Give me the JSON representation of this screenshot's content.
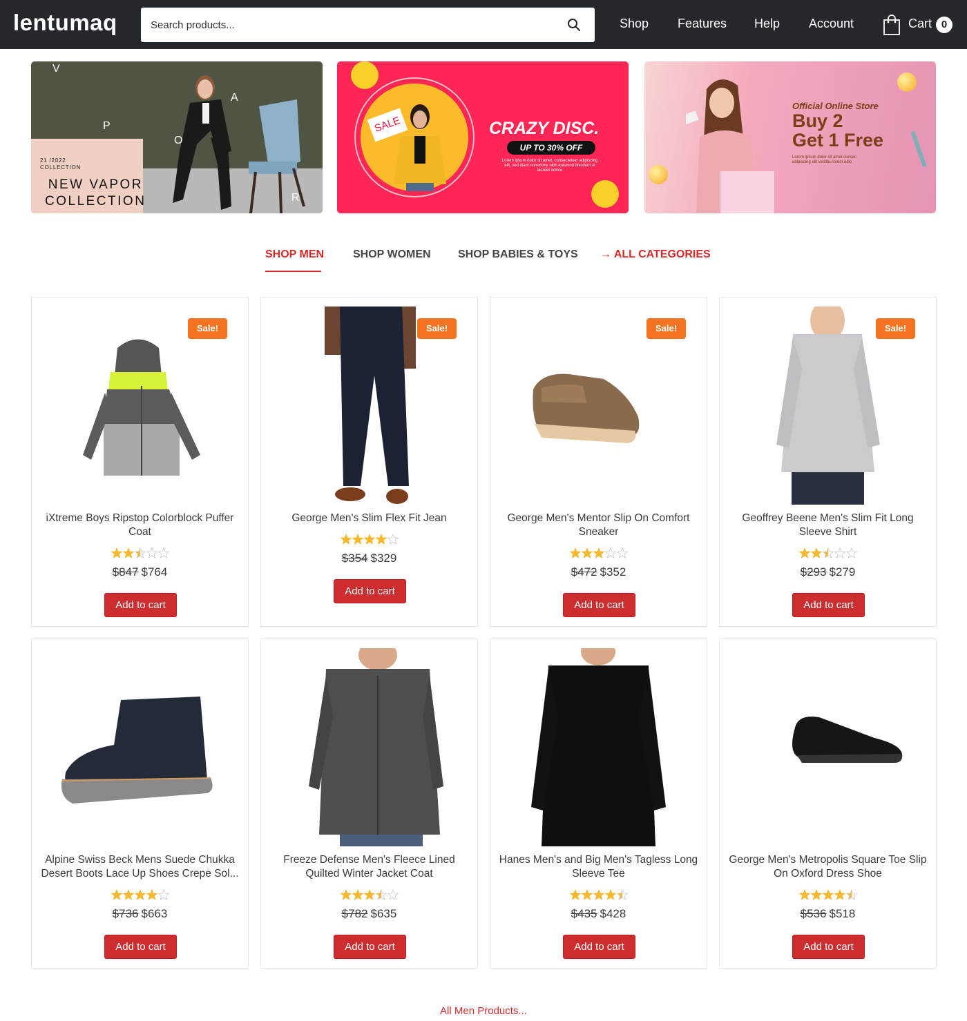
{
  "header": {
    "logo": "lentumaq",
    "search_placeholder": "Search products...",
    "search_icon": "search-icon",
    "nav": [
      "Shop",
      "Features",
      "Help",
      "Account"
    ],
    "cart_label": "Cart",
    "cart_count": "0",
    "cart_icon": "shopping-bag-icon"
  },
  "banners": [
    {
      "letters": [
        "V",
        "A",
        "P",
        "O",
        "R"
      ],
      "small_line1": "21 /2022",
      "small_line2": "COLLECTION",
      "title_line1": "NEW VAPOR",
      "title_line2": "COLLECTION"
    },
    {
      "sign": "SALE",
      "title": "CRAZY DISC.",
      "pill": "UP TO 30% OFF",
      "lorem": "Lorem ipsum dolor sit amet, consectetuer adipiscing elit, sed diam nonummy nibh euismod tincidunt ut laoreet dolore"
    },
    {
      "sub": "Official Online Store",
      "title_line1": "Buy 2",
      "title_line2": "Get 1 Free",
      "lorem": "Lorem ipsum dolor sit amet consec adipiscing elit vestibu lorem odio"
    }
  ],
  "tabs": [
    {
      "label": "SHOP MEN",
      "active": true
    },
    {
      "label": "SHOP WOMEN",
      "active": false
    },
    {
      "label": "SHOP BABIES & TOYS",
      "active": false
    },
    {
      "label": "→ ALL CATEGORIES",
      "active": false
    }
  ],
  "colors": {
    "accent": "#d42a2a",
    "header_bg": "#24282c",
    "sale_badge": "#f47320",
    "button": "#cd2d2f",
    "star": "#f5b82e"
  },
  "sale_label": "Sale!",
  "add_to_cart_label": "Add to cart",
  "products": [
    {
      "title": "iXtreme Boys Ripstop Colorblock Puffer Coat",
      "rating": 2.5,
      "old_price": "$847",
      "price": "$764",
      "sale": true
    },
    {
      "title": "George Men's Slim Flex Fit Jean",
      "rating": 4,
      "old_price": "$354",
      "price": "$329",
      "sale": true
    },
    {
      "title": "George Men's Mentor Slip On Comfort Sneaker",
      "rating": 3,
      "old_price": "$472",
      "price": "$352",
      "sale": true
    },
    {
      "title": "Geoffrey Beene Men's Slim Fit Long Sleeve Shirt",
      "rating": 2.5,
      "old_price": "$293",
      "price": "$279",
      "sale": true
    },
    {
      "title": "Alpine Swiss Beck Mens Suede Chukka Desert Boots Lace Up Shoes Crepe Sol...",
      "rating": 4,
      "old_price": "$736",
      "price": "$663",
      "sale": false
    },
    {
      "title": "Freeze Defense Men's Fleece Lined Quilted Winter Jacket Coat",
      "rating": 3.5,
      "old_price": "$782",
      "price": "$635",
      "sale": false
    },
    {
      "title": "Hanes Men's and Big Men's Tagless Long Sleeve Tee",
      "rating": 4.5,
      "old_price": "$435",
      "price": "$428",
      "sale": false
    },
    {
      "title": "George Men's Metropolis Square Toe Slip On Oxford Dress Shoe",
      "rating": 4.5,
      "old_price": "$536",
      "price": "$518",
      "sale": false
    }
  ],
  "footer_link": "All Men Products..."
}
